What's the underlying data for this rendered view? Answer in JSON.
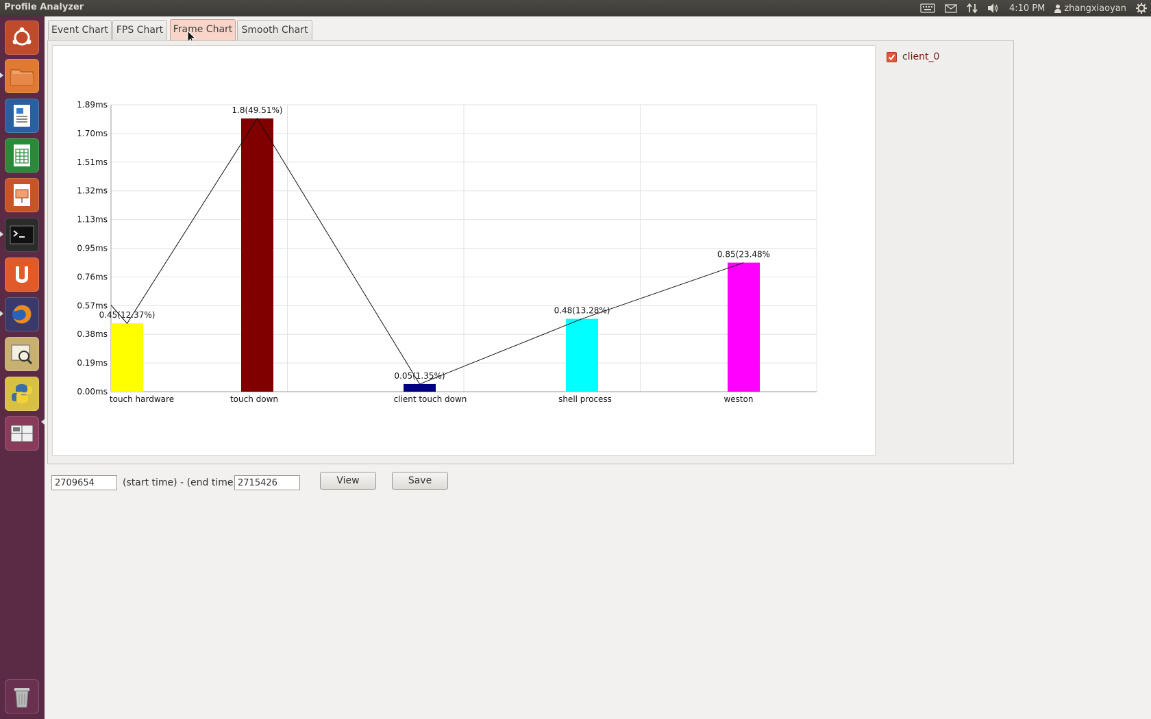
{
  "window": {
    "title": "Profile Analyzer"
  },
  "panel_indicators": {
    "clock": "4:10 PM",
    "user": "zhangxiaoyan"
  },
  "launcher": {
    "items": [
      "ubuntu-dash-icon",
      "files-icon",
      "writer-icon",
      "calc-icon",
      "impress-icon",
      "terminal-icon",
      "software-center-icon",
      "firefox-icon",
      "image-viewer-icon",
      "python-icon",
      "workspace-switcher-icon"
    ],
    "trash": "trash-icon"
  },
  "tabs": [
    {
      "label": "Event Chart",
      "active": false
    },
    {
      "label": "FPS Chart",
      "active": false
    },
    {
      "label": "Frame Chart",
      "active": true
    },
    {
      "label": "Smooth Chart",
      "active": false
    }
  ],
  "legend": {
    "label": "client_0",
    "checked": true
  },
  "controls": {
    "start_time": "2709654",
    "range_text": "(start time) - (end time)",
    "end_time": "2715426",
    "view_label": "View",
    "save_label": "Save"
  },
  "chart_data": {
    "type": "bar",
    "categories": [
      "touch hardware",
      "touch down",
      "client touch down",
      "shell process",
      "weston"
    ],
    "values": [
      0.45,
      1.8,
      0.05,
      0.48,
      0.85
    ],
    "data_labels": [
      "0.45(12.37%)",
      "1.8(49.51%)",
      "0.05(1.35%)",
      "0.48(13.28%)",
      "0.85(23.48%"
    ],
    "colors": [
      "#ffff00",
      "#800000",
      "#000080",
      "#00ffff",
      "#ff00ff"
    ],
    "line_overlay": true,
    "yticks": [
      "0.00ms",
      "0.19ms",
      "0.38ms",
      "0.57ms",
      "0.76ms",
      "0.95ms",
      "1.13ms",
      "1.32ms",
      "1.51ms",
      "1.70ms",
      "1.89ms"
    ],
    "ylim": [
      0,
      1.89
    ],
    "grid": true
  }
}
